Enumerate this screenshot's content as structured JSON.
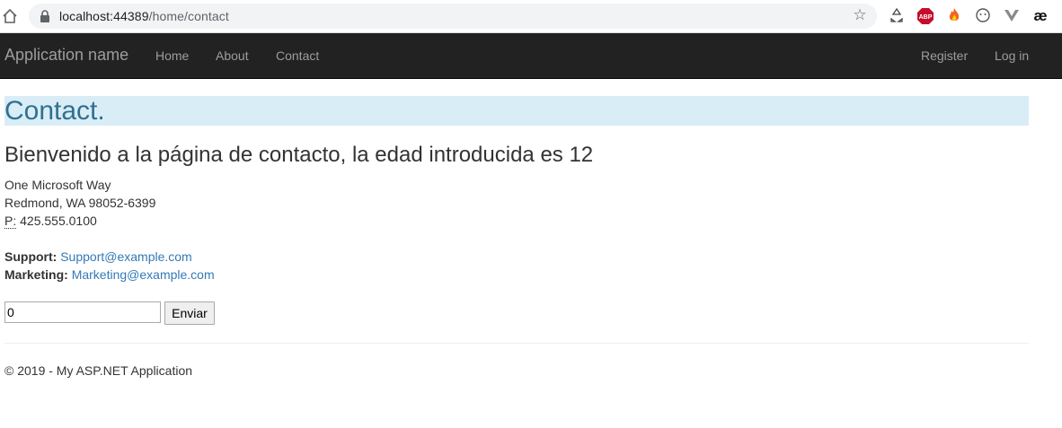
{
  "browser": {
    "url_host": "localhost:44389",
    "url_path": "/home/contact",
    "extensions": [
      "recycle-icon",
      "abp-icon",
      "fire-icon",
      "smile-icon",
      "vue-icon",
      "ae-icon"
    ],
    "abp_label": "ABP",
    "ae_label": "æ"
  },
  "navbar": {
    "brand": "Application name",
    "links": [
      "Home",
      "About",
      "Contact"
    ],
    "right_links": [
      "Register",
      "Log in"
    ],
    "background": "#222222",
    "link_color": "#9d9d9d"
  },
  "main": {
    "title": "Contact.",
    "welcome": "Bienvenido a la página de contacto, la edad introducida es 12",
    "address": {
      "line1": "One Microsoft Way",
      "line2": "Redmond, WA 98052-6399",
      "phone_label": "P:",
      "phone": "425.555.0100"
    },
    "support_label": "Support:",
    "support_email": "Support@example.com",
    "marketing_label": "Marketing:",
    "marketing_email": "Marketing@example.com",
    "age_input_value": "0",
    "submit_label": "Enviar"
  },
  "footer": {
    "text": "© 2019 - My ASP.NET Application"
  },
  "colors": {
    "title_bg": "#d9edf7",
    "title_fg": "#31708f",
    "link": "#337ab7"
  }
}
